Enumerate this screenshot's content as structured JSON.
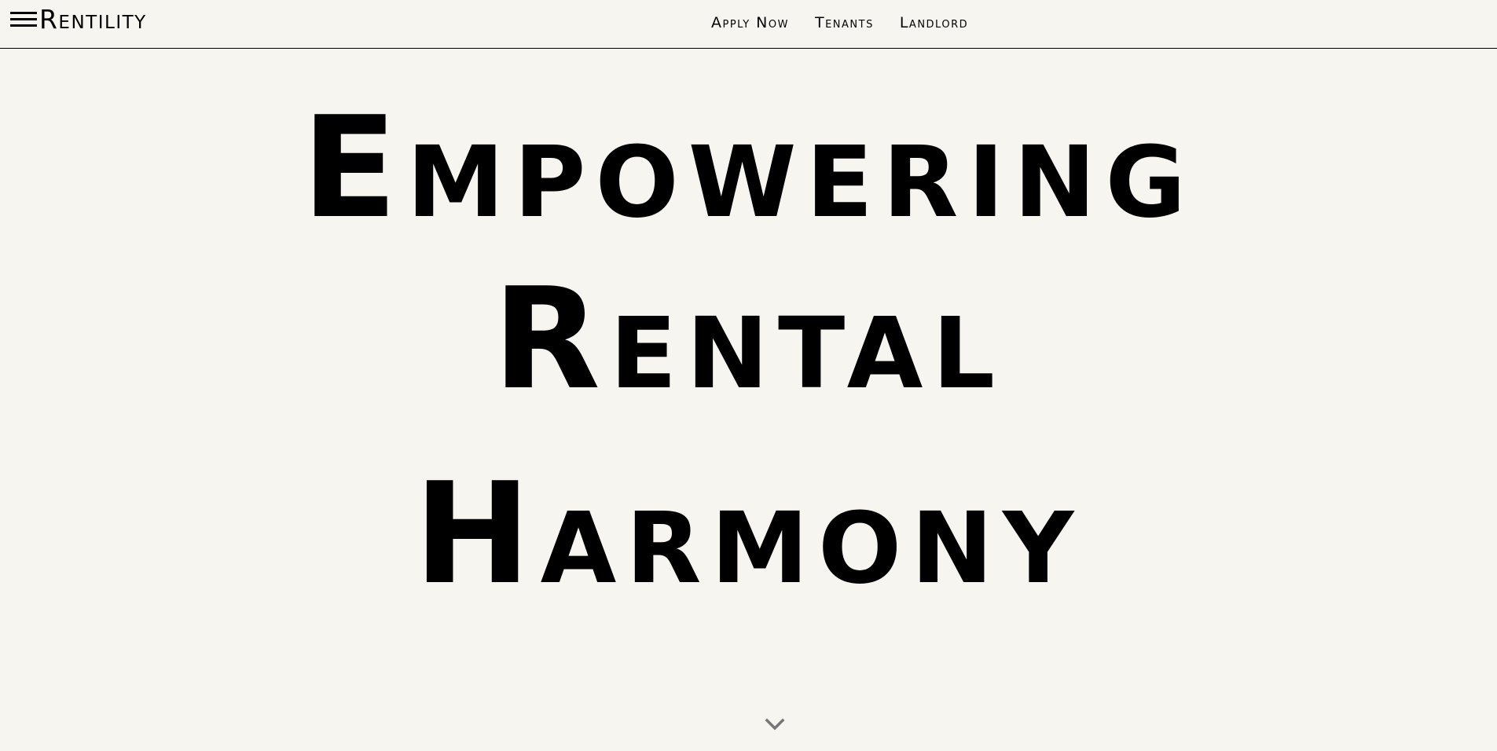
{
  "header": {
    "logo": "Rentility",
    "menu_icon": "hamburger-menu-icon",
    "nav": [
      {
        "label": "Apply Now"
      },
      {
        "label": "Tenants"
      },
      {
        "label": "Landlord"
      }
    ]
  },
  "hero": {
    "lines": [
      "Empowering",
      "Rental",
      "Harmony"
    ]
  },
  "scroll": {
    "icon": "chevron-down-icon",
    "color": "#777777"
  }
}
